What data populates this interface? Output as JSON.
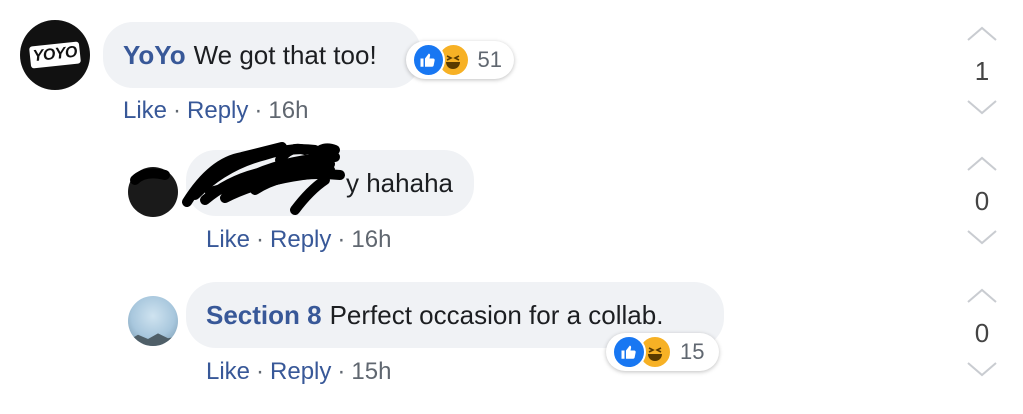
{
  "comments": [
    {
      "avatar_text": "YOYO",
      "author": "YoYo",
      "text": "We got that too!",
      "actions": {
        "like": "Like",
        "reply": "Reply",
        "time": "16h"
      },
      "reactions": {
        "icons": [
          "like-icon",
          "haha-icon"
        ],
        "count": "51"
      },
      "votes": "1"
    },
    {
      "author": "",
      "text": "y hahaha",
      "actions": {
        "like": "Like",
        "reply": "Reply",
        "time": "16h"
      },
      "votes": "0"
    },
    {
      "author": "Section 8",
      "text": "Perfect occasion for a collab.",
      "actions": {
        "like": "Like",
        "reply": "Reply",
        "time": "15h"
      },
      "reactions": {
        "icons": [
          "like-icon",
          "haha-icon"
        ],
        "count": "15"
      },
      "votes": "0"
    }
  ],
  "separator": "·",
  "colors": {
    "link": "#385898",
    "bubble": "#f0f2f5",
    "like": "#1877f2",
    "haha": "#f7b125"
  }
}
